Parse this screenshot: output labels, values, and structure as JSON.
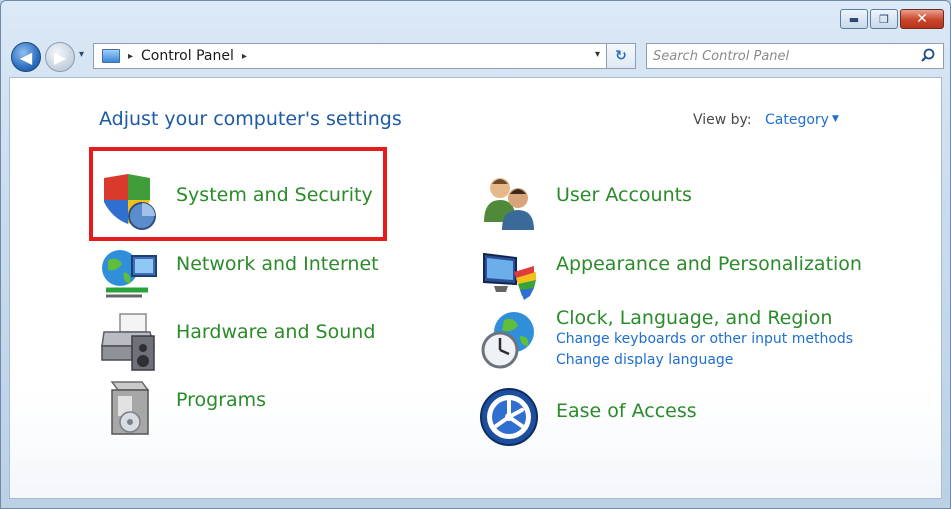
{
  "window": {
    "caption": {
      "minimize_label": "▬",
      "maximize_label": "❐",
      "close_label": "✕"
    }
  },
  "navbar": {
    "back_label": "◀",
    "forward_label": "▶",
    "history_label": "▾",
    "breadcrumb": [
      "Control Panel"
    ],
    "breadcrumb_arrow": "▸",
    "dropdown_label": "▾",
    "refresh_label": "↻",
    "search": {
      "placeholder": "Search Control Panel",
      "value": ""
    }
  },
  "content": {
    "page_title": "Adjust your computer's settings",
    "view_by": {
      "label": "View by:",
      "value": "Category",
      "caret": "▼"
    },
    "categories": [
      {
        "title": "System and Security",
        "icon": "shield-icon",
        "links": []
      },
      {
        "title": "Network and Internet",
        "icon": "globe-network-icon",
        "links": []
      },
      {
        "title": "Hardware and Sound",
        "icon": "printer-speaker-icon",
        "links": []
      },
      {
        "title": "Programs",
        "icon": "programs-box-icon",
        "links": []
      },
      {
        "title": "User Accounts",
        "icon": "users-icon",
        "links": []
      },
      {
        "title": "Appearance and Personalization",
        "icon": "monitor-palette-icon",
        "links": []
      },
      {
        "title": "Clock, Language, and Region",
        "icon": "globe-clock-icon",
        "links": [
          "Change keyboards or other input methods",
          "Change display language"
        ]
      },
      {
        "title": "Ease of Access",
        "icon": "ease-of-access-icon",
        "links": []
      }
    ]
  },
  "colors": {
    "category_title": "#2a8b2a",
    "link": "#1e6fd0",
    "page_title": "#1d5aa6",
    "highlight_border": "#e51c1c"
  }
}
